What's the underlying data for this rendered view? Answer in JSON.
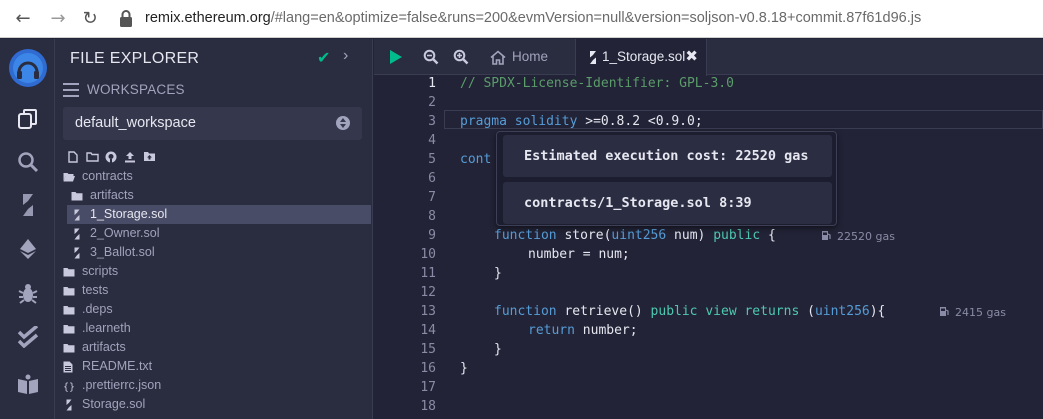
{
  "browser": {
    "back": "←",
    "forward": "→",
    "reload": "↻",
    "url_host": "remix.ethereum.org",
    "url_rest": "/#lang=en&optimize=false&runs=200&evmVersion=null&version=soljson-v0.8.18+commit.87f61d96.js"
  },
  "panel": {
    "title": "FILE EXPLORER",
    "check": "✔",
    "chevron": "›",
    "workspaces_label": "WORKSPACES",
    "workspace_selected": "default_workspace"
  },
  "tree": [
    {
      "label": "contracts",
      "icon": "folder-open-icon",
      "level": 0
    },
    {
      "label": "artifacts",
      "icon": "folder-icon",
      "level": 1
    },
    {
      "label": "1_Storage.sol",
      "icon": "solidity-icon",
      "level": 1,
      "selected": true
    },
    {
      "label": "2_Owner.sol",
      "icon": "solidity-icon",
      "level": 1
    },
    {
      "label": "3_Ballot.sol",
      "icon": "solidity-icon",
      "level": 1
    },
    {
      "label": "scripts",
      "icon": "folder-icon",
      "level": 0
    },
    {
      "label": "tests",
      "icon": "folder-icon",
      "level": 0
    },
    {
      "label": ".deps",
      "icon": "folder-icon",
      "level": 0
    },
    {
      "label": ".learneth",
      "icon": "folder-icon",
      "level": 0
    },
    {
      "label": "artifacts",
      "icon": "folder-icon",
      "level": 0
    },
    {
      "label": "README.txt",
      "icon": "file-text-icon",
      "level": 0
    },
    {
      "label": ".prettierrc.json",
      "icon": "json-icon",
      "level": 0
    },
    {
      "label": "Storage.sol",
      "icon": "solidity-icon",
      "level": 0
    }
  ],
  "editor": {
    "tab_home": "Home",
    "tab_file": "1_Storage.sol",
    "tab_close": "✖",
    "line_numbers": [
      "1",
      "2",
      "3",
      "4",
      "5",
      "6",
      "7",
      "8",
      "9",
      "10",
      "11",
      "12",
      "13",
      "14",
      "15",
      "16",
      "17",
      "18"
    ],
    "code": {
      "l1": "// SPDX-License-Identifier: GPL-3.0",
      "l3_kw1": "pragma",
      "l3_kw2": "solidity",
      "l3_rest": " >=0.8.2 <0.9.0;",
      "l5_partial": "cont",
      "l9_kw": "function",
      "l9_name": " store(",
      "l9_type": "uint256",
      "l9_arg": " num) ",
      "l9_vis": "public",
      "l9_end": " {",
      "l10": "number = num;",
      "l11": "}",
      "l13_kw": "function",
      "l13_name": " retrieve() ",
      "l13_vis": "public",
      "l13_view": "view",
      "l13_ret": "returns",
      "l13_open": " (",
      "l13_type": "uint256",
      "l13_end": "){",
      "l14_kw": "return",
      "l14_rest": " number;",
      "l15": "}",
      "l16": "}"
    },
    "gas_store": "22520 gas",
    "gas_retrieve": "2415 gas"
  },
  "tooltip": {
    "cost": "Estimated execution cost: 22520 gas",
    "location": "contracts/1_Storage.sol 8:39"
  },
  "colors": {
    "accent_green": "#00bc8c",
    "background": "#222336",
    "panel": "#2a2c3f"
  }
}
